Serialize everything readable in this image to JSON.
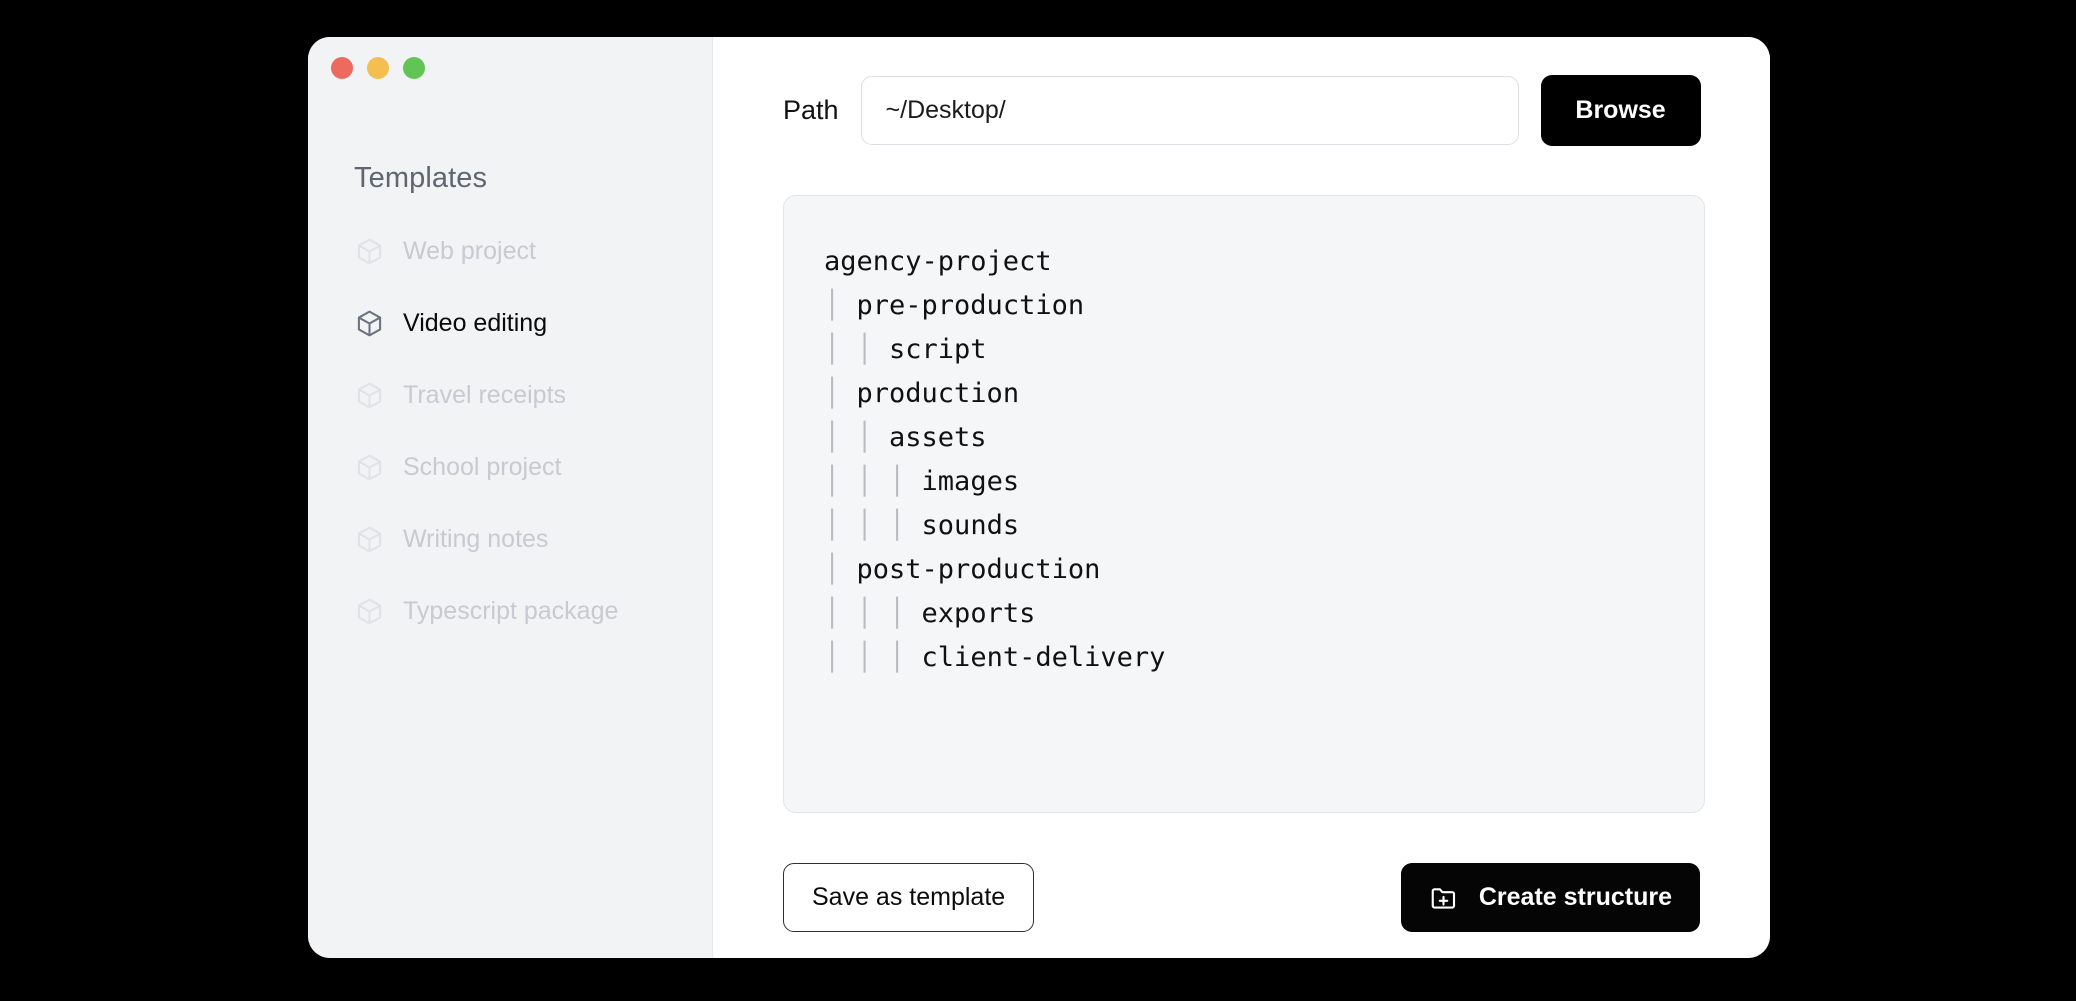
{
  "window": {
    "traffic_lights": [
      {
        "name": "close",
        "color": "#ed6a5e"
      },
      {
        "name": "minimize",
        "color": "#f4bf50"
      },
      {
        "name": "maximize",
        "color": "#61c454"
      }
    ]
  },
  "sidebar": {
    "title": "Templates",
    "items": [
      {
        "label": "Web project",
        "icon": "cube-icon",
        "active": false
      },
      {
        "label": "Video editing",
        "icon": "cube-icon",
        "active": true
      },
      {
        "label": "Travel receipts",
        "icon": "cube-icon",
        "active": false
      },
      {
        "label": "School project",
        "icon": "cube-icon",
        "active": false
      },
      {
        "label": "Writing notes",
        "icon": "cube-icon",
        "active": false
      },
      {
        "label": "Typescript package",
        "icon": "cube-icon",
        "active": false
      }
    ]
  },
  "main": {
    "path_label": "Path",
    "path_value": "~/Desktop/",
    "path_placeholder": "~/Desktop/",
    "browse_label": "Browse",
    "tree_lines": [
      {
        "guides": 0,
        "name": "agency-project"
      },
      {
        "guides": 1,
        "name": "pre-production"
      },
      {
        "guides": 2,
        "name": "script"
      },
      {
        "guides": 1,
        "name": "production"
      },
      {
        "guides": 2,
        "name": "assets"
      },
      {
        "guides": 3,
        "name": "images"
      },
      {
        "guides": 3,
        "name": "sounds"
      },
      {
        "guides": 1,
        "name": "post-production"
      },
      {
        "guides": 3,
        "name": "exports"
      },
      {
        "guides": 3,
        "name": "client-delivery"
      }
    ],
    "save_label": "Save as template",
    "create_label": "Create structure",
    "create_icon": "folder-plus-icon"
  },
  "colors": {
    "accent": "#000000",
    "sidebar_bg": "#f1f3f4",
    "panel_bg": "#f5f6f7",
    "muted_text": "#c6cbd1"
  }
}
